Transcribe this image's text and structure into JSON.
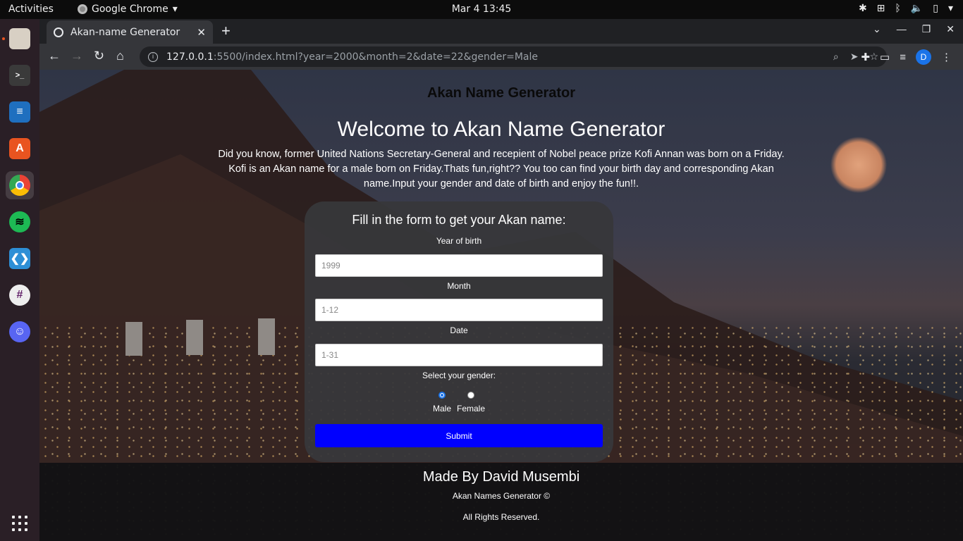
{
  "system": {
    "activities": "Activities",
    "app_name": "Google Chrome",
    "clock": "Mar 4  13:45"
  },
  "dock": {
    "items": [
      {
        "name": "files",
        "icon": "files-icon",
        "color": "#c9c1b4",
        "running": true
      },
      {
        "name": "terminal",
        "icon": "terminal-icon",
        "color": "#3a3a3a",
        "running": true
      },
      {
        "name": "writer",
        "icon": "libreoffice-writer-icon",
        "color": "#1f6fbf",
        "running": false
      },
      {
        "name": "software",
        "icon": "ubuntu-software-icon",
        "color": "#e95420",
        "running": false
      },
      {
        "name": "chrome",
        "icon": "chrome-icon",
        "color": "#4285f4",
        "running": true
      },
      {
        "name": "spotify",
        "icon": "spotify-icon",
        "color": "#1db954",
        "running": false
      },
      {
        "name": "vscode",
        "icon": "vscode-icon",
        "color": "#2d8fd6",
        "running": true
      },
      {
        "name": "slack",
        "icon": "slack-icon",
        "color": "#e8e8e8",
        "running": true
      },
      {
        "name": "discord",
        "icon": "discord-icon",
        "color": "#5865f2",
        "running": false
      }
    ]
  },
  "browser": {
    "tab_title": "Akan-name Generator",
    "url_host": "127.0.0.1",
    "url_rest": ":5500/index.html?year=2000&month=2&date=22&gender=Male",
    "profile_initial": "D"
  },
  "page": {
    "site_title": "Akan Name Generator",
    "hero_title": "Welcome to Akan Name Generator",
    "hero_text": "Did you know, former United Nations Secretary-General and recepient of Nobel peace prize Kofi Annan was born on a Friday. Kofi is an Akan name for a male born on Friday.Thats fun,right?? You too can find your birth day and corresponding Akan name.Input your gender and date of birth and enjoy the fun!!.",
    "form": {
      "title": "Fill in the form to get your Akan name:",
      "year_label": "Year of birth",
      "year_placeholder": "1999",
      "month_label": "Month",
      "month_placeholder": "1-12",
      "date_label": "Date",
      "date_placeholder": "1-31",
      "gender_label": "Select your gender:",
      "gender_options": [
        {
          "label": "Male",
          "checked": true
        },
        {
          "label": "Female",
          "checked": false
        }
      ],
      "submit_label": "Submit",
      "submit_color": "#0000ff"
    },
    "footer": {
      "made_by": "Made By David Musembi",
      "copyright": "Akan Names Generator ©",
      "rights": "All Rights Reserved."
    }
  }
}
